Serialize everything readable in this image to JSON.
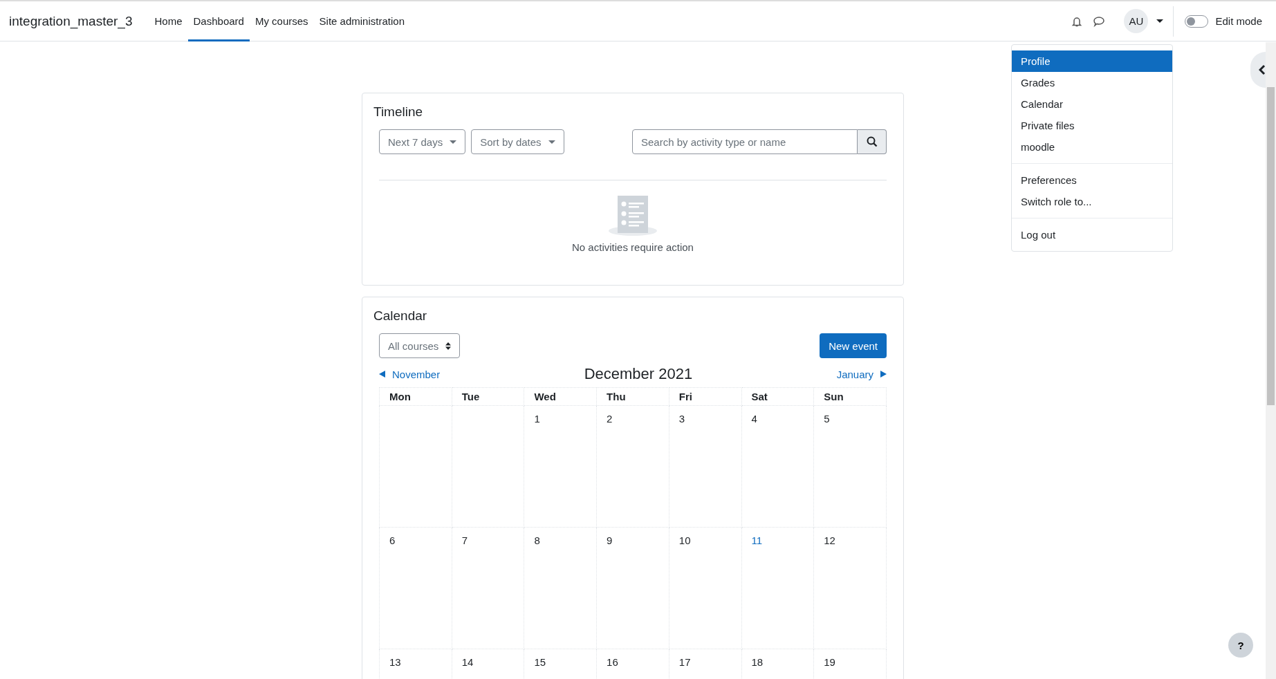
{
  "navbar": {
    "site_name": "integration_master_3",
    "items": [
      {
        "label": "Home",
        "selected": false
      },
      {
        "label": "Dashboard",
        "selected": true
      },
      {
        "label": "My courses",
        "selected": false
      },
      {
        "label": "Site administration",
        "selected": false
      }
    ],
    "avatar": "AU",
    "edit_mode": {
      "label": "Edit mode",
      "on": false
    }
  },
  "user_menu": {
    "groups": [
      [
        {
          "label": "Profile",
          "selected": true
        },
        {
          "label": "Grades",
          "selected": false
        },
        {
          "label": "Calendar",
          "selected": false
        },
        {
          "label": "Private files",
          "selected": false
        },
        {
          "label": "moodle",
          "selected": false
        }
      ],
      [
        {
          "label": "Preferences",
          "selected": false
        },
        {
          "label": "Switch role to...",
          "selected": false
        }
      ],
      [
        {
          "label": "Log out",
          "selected": false
        }
      ]
    ]
  },
  "timeline": {
    "title": "Timeline",
    "filters": [
      "Next 7 days",
      "Sort by dates"
    ],
    "search": {
      "placeholder": "Search by activity type or name"
    },
    "empty_message": "No activities require action"
  },
  "calendar": {
    "title": "Calendar",
    "course_select": "All courses",
    "new_event": "New event",
    "prev": "November",
    "month": "December 2021",
    "next": "January",
    "weekdays": [
      "Mon",
      "Tue",
      "Wed",
      "Thu",
      "Fri",
      "Sat",
      "Sun"
    ],
    "weeks": [
      [
        {
          "day": "1",
          "today": false
        },
        {
          "day": "2",
          "today": false
        },
        {
          "day": "3",
          "today": false
        },
        {
          "day": "4",
          "today": false
        },
        {
          "day": "5",
          "today": false
        }
      ],
      [
        {
          "day": "6",
          "today": false
        },
        {
          "day": "7",
          "today": false
        },
        {
          "day": "8",
          "today": false
        },
        {
          "day": "9",
          "today": false
        },
        {
          "day": "10",
          "today": false
        },
        {
          "day": "11",
          "today": true
        },
        {
          "day": "12",
          "today": false
        }
      ],
      [
        {
          "day": "13",
          "today": false
        },
        {
          "day": "14",
          "today": false
        },
        {
          "day": "15",
          "today": false
        },
        {
          "day": "16",
          "today": false
        },
        {
          "day": "17",
          "today": false
        },
        {
          "day": "18",
          "today": false
        },
        {
          "day": "19",
          "today": false
        }
      ]
    ]
  },
  "help_button": "?"
}
